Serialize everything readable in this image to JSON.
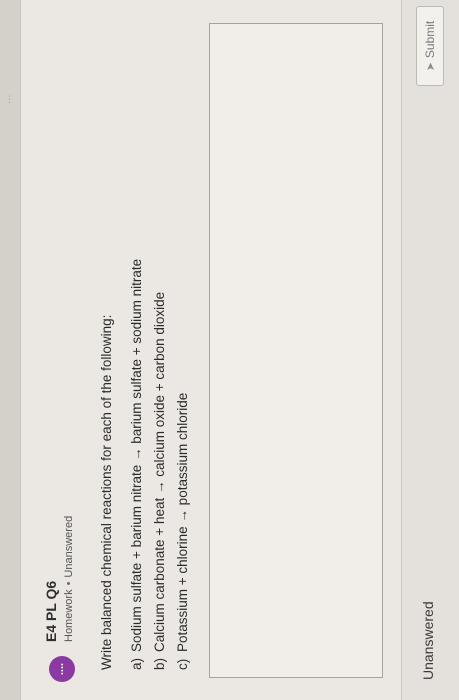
{
  "header": {
    "faded_title": "...",
    "badge_text": "...."
  },
  "question": {
    "title": "E4 PL Q6",
    "category": "Homework",
    "separator": "•",
    "status": "Unanswered",
    "prompt": "Write balanced chemical reactions for each of the following:",
    "items": [
      {
        "letter": "a)",
        "text": "Sodium sulfate + barium nitrate → barium sulfate + sodium nitrate"
      },
      {
        "letter": "b)",
        "text": "Calcium carbonate + heat → calcium oxide + carbon dioxide"
      },
      {
        "letter": "c)",
        "text": "Potassium + chlorine → potassium chloride"
      }
    ]
  },
  "answer": {
    "value": ""
  },
  "footer": {
    "status": "Unanswered",
    "submit_label": "Submit",
    "submit_icon": "send-icon"
  }
}
